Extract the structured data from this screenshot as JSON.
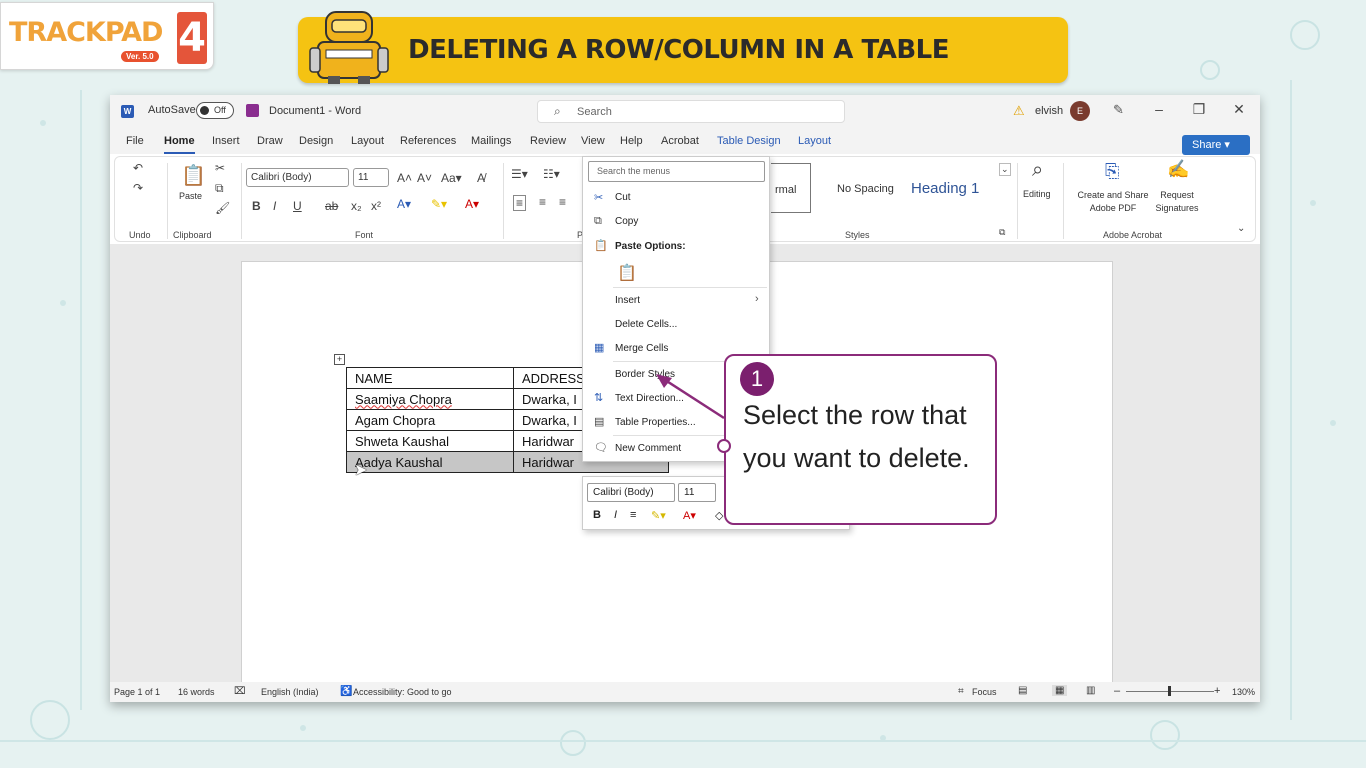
{
  "brand": {
    "logo_text": "TRACKPAD",
    "logo_version": "Ver. 5.0",
    "logo_number": "4"
  },
  "banner": {
    "title": "DELETING A ROW/COLUMN IN A TABLE"
  },
  "word": {
    "autosave_label": "AutoSave",
    "autosave_state": "Off",
    "doc_title": "Document1 - Word",
    "search_placeholder": "Search",
    "user_name": "elvish",
    "user_initial": "E",
    "menu": [
      "File",
      "Home",
      "Insert",
      "Draw",
      "Design",
      "Layout",
      "References",
      "Mailings",
      "Review",
      "View",
      "Help",
      "Acrobat",
      "Table Design",
      "Layout"
    ],
    "share_label": "Share",
    "ribbon": {
      "paste_label": "Paste",
      "undo_group": "Undo",
      "clipboard_group": "Clipboard",
      "font_name": "Calibri (Body)",
      "font_size": "11",
      "font_group": "Font",
      "paragraph_group": "P",
      "styles": [
        "rmal",
        "No Spacing",
        "Heading 1"
      ],
      "styles_group": "Styles",
      "editing_label": "Editing",
      "create_share_pdf": "Create and Share Adobe PDF",
      "request_signatures": "Request Signatures",
      "adobe_group": "Adobe Acrobat",
      "bold": "B",
      "italic": "I",
      "underline": "U",
      "strike": "ab"
    },
    "table": {
      "rows": [
        [
          "NAME",
          "ADDRESS"
        ],
        [
          "Saamiya Chopra",
          "Dwarka, I"
        ],
        [
          "Agam Chopra",
          "Dwarka, I"
        ],
        [
          "Shweta Kaushal",
          "Haridwar"
        ],
        [
          "Aadya Kaushal",
          "Haridwar"
        ]
      ]
    },
    "status": {
      "page": "Page 1 of 1",
      "words": "16 words",
      "language": "English (India)",
      "accessibility": "Accessibility: Good to go",
      "focus": "Focus",
      "zoom": "130%"
    }
  },
  "context_menu": {
    "search_placeholder": "Search the menus",
    "items": {
      "cut": "Cut",
      "copy": "Copy",
      "paste_options": "Paste Options:",
      "insert": "Insert",
      "delete_cells": "Delete Cells...",
      "merge_cells": "Merge Cells",
      "border_styles": "Border Styles",
      "text_direction": "Text Direction...",
      "table_properties": "Table Properties...",
      "new_comment": "New Comment"
    }
  },
  "mini_toolbar": {
    "font_name": "Calibri (Body)",
    "font_size": "11",
    "bold": "B",
    "italic": "I"
  },
  "callout": {
    "step": "1",
    "text": "Select the row that you want to delete."
  },
  "colors": {
    "banner": "#f5c312",
    "callout_border": "#8b2b7a",
    "word_blue": "#2b5bb5"
  }
}
